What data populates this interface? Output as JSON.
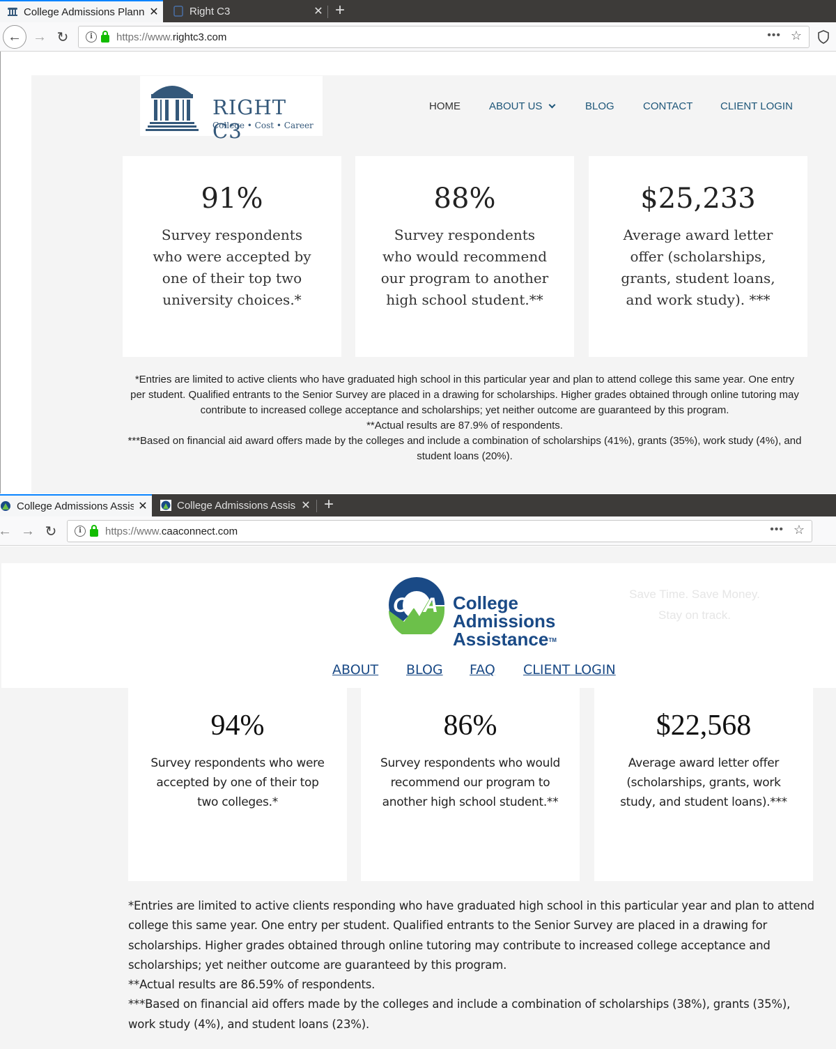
{
  "window1": {
    "tabs": [
      {
        "title": "College Admissions Plann",
        "active": true
      },
      {
        "title": "Right C3",
        "active": false
      }
    ],
    "url_proto": "https://www.",
    "url_host": "rightc3.com",
    "site": {
      "logo_brand": "RIGHT C3",
      "logo_tagline": "College  •  Cost  •  Career",
      "nav": [
        "HOME",
        "ABOUT US",
        "BLOG",
        "CONTACT",
        "CLIENT LOGIN"
      ],
      "stats": [
        {
          "value": "91%",
          "desc": "Survey respondents who were accepted by one of their top two university choices.*"
        },
        {
          "value": "88%",
          "desc": "Survey respondents who would recommend our program to another high school student.**"
        },
        {
          "value": "$25,233",
          "desc": "Average award letter offer (scholarships, grants, student loans, and work study). ***"
        }
      ],
      "footnotes": [
        "*Entries are limited to active clients who have graduated high school in this particular year and plan to attend college this same year. One entry per student. Qualified entrants to the Senior Survey are placed in a drawing for scholarships. Higher grades obtained through online tutoring may contribute to increased college acceptance and scholarships; yet neither outcome are guaranteed by this program.",
        "**Actual results are 87.9% of respondents.",
        "***Based on financial aid award offers made by the colleges and include a combination of scholarships (41%), grants (35%), work study (4%), and student loans (20%)."
      ]
    }
  },
  "window2": {
    "tabs": [
      {
        "title": "College Admissions Assis",
        "active": true
      },
      {
        "title": "College Admissions Assis",
        "active": false
      }
    ],
    "url_proto": "https://www.",
    "url_host": "caaconnect.com",
    "site": {
      "logo_lines": [
        "College",
        "Admissions",
        "Assistance"
      ],
      "logo_mark": "CAA",
      "logo_tm": "TM",
      "tagline_lines": [
        "Save Time. Save Money.",
        "Stay on track."
      ],
      "nav": [
        "ABOUT",
        "BLOG",
        "FAQ",
        "CLIENT LOGIN"
      ],
      "stats": [
        {
          "value": "94%",
          "desc": "Survey respondents who were accepted by one of their top two colleges.*"
        },
        {
          "value": "86%",
          "desc": "Survey respondents who would recommend our program to another high school student.**"
        },
        {
          "value": "$22,568",
          "desc": "Average award letter offer (scholarships, grants, work study, and student loans).***"
        }
      ],
      "footnotes": [
        "*Entries are limited to active clients responding who have graduated high school in this particular year and plan to attend college this same year. One entry per student. Qualified entrants to the Senior Survey are placed in a drawing for scholarships. Higher grades obtained through online tutoring may contribute to increased college acceptance and scholarships; yet neither outcome are guaranteed by this program.",
        "**Actual results are 86.59% of respondents.",
        "***Based on financial aid offers made by the colleges and include a combination of scholarships (38%), grants (35%), work study (4%), and student loans (23%)."
      ]
    }
  },
  "colors": {
    "chrome_dark": "#3d3b39",
    "rc_blue": "#34587a",
    "caa_blue": "#1a4a86",
    "caa_green": "#6cc04a"
  }
}
